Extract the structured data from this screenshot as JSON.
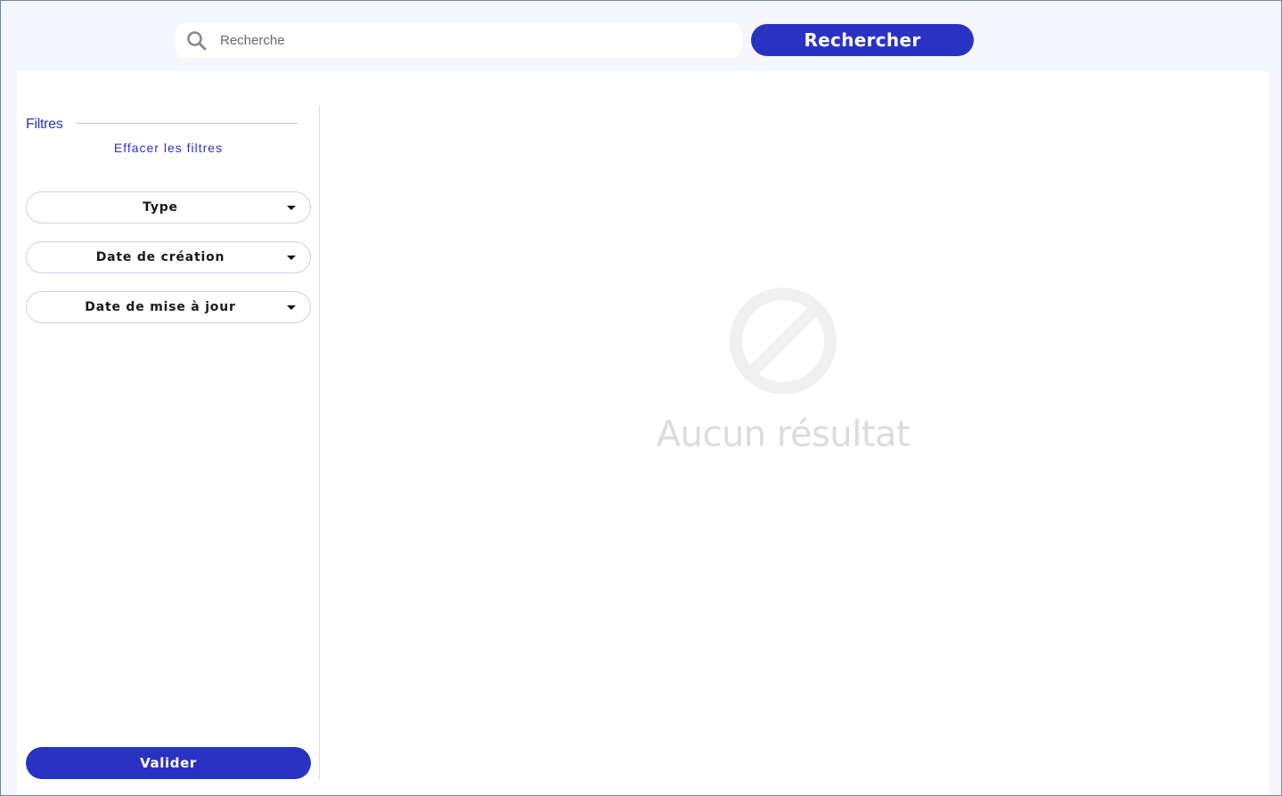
{
  "search": {
    "placeholder": "Recherche",
    "value": "",
    "button_label": "Rechercher"
  },
  "filters": {
    "title": "Filtres",
    "clear_label": "Effacer les filtres",
    "items": [
      {
        "label": "Type"
      },
      {
        "label": "Date de création"
      },
      {
        "label": "Date de mise à jour"
      }
    ],
    "validate_label": "Valider"
  },
  "results": {
    "empty_message": "Aucun résultat"
  },
  "icons": {
    "search": "search-icon",
    "caret": "caret-down-icon",
    "empty": "no-entry-icon"
  },
  "colors": {
    "accent": "#2a32c4",
    "background": "#f5f7fc",
    "empty_state": "#dcdcdc"
  }
}
